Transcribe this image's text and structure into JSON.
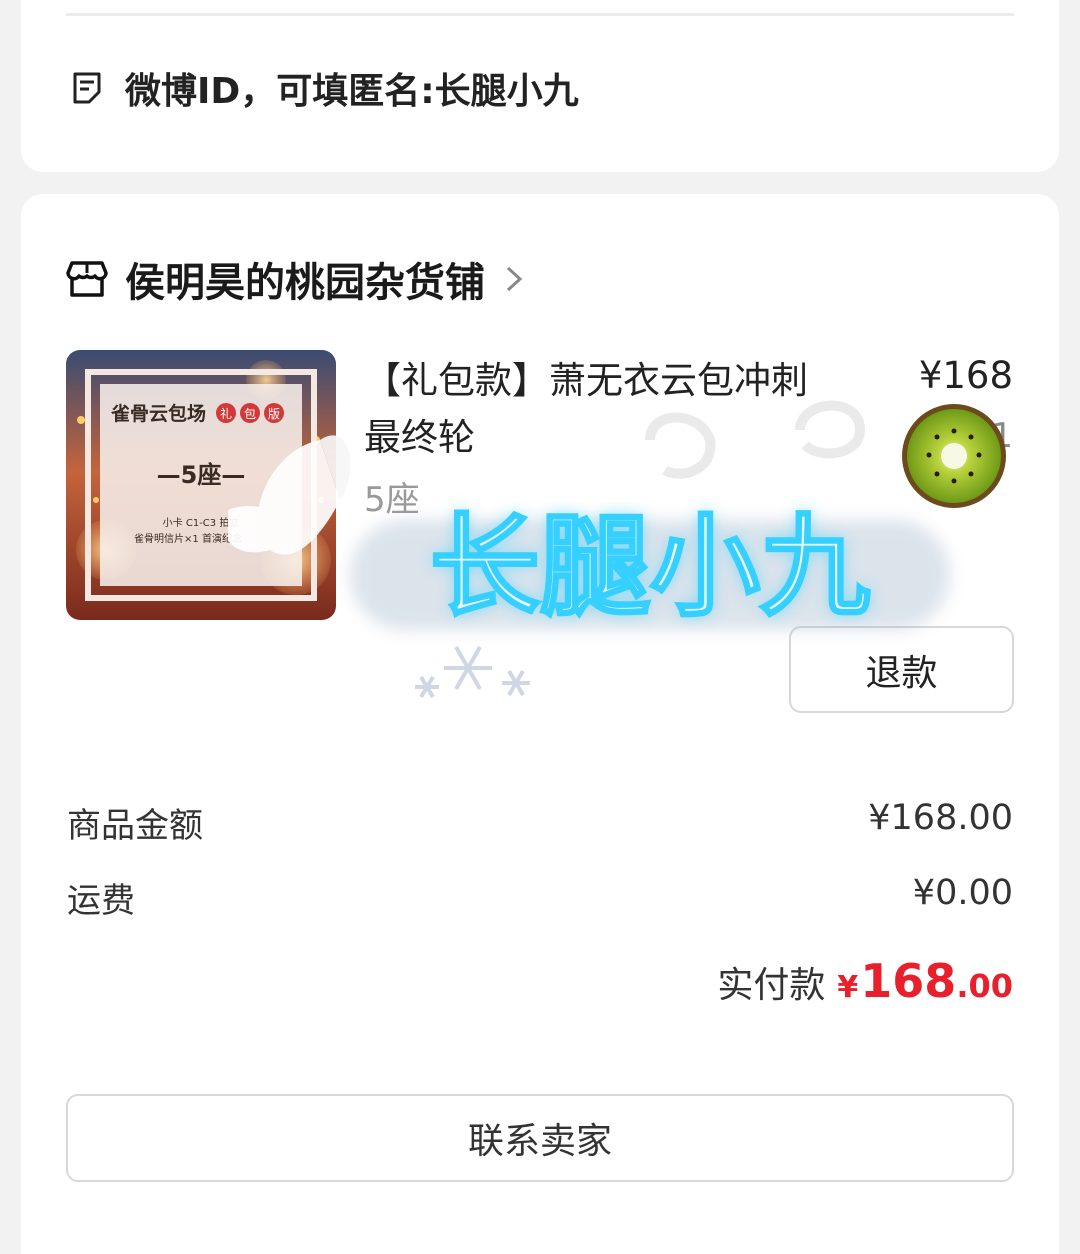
{
  "remark": {
    "text": "微博ID，可填匿名:长腿小九"
  },
  "shop": {
    "name": "侯明昊的桃园杂货铺"
  },
  "product": {
    "title": "【礼包款】萧无衣云包冲刺最终轮",
    "spec": "5座",
    "price": "¥168",
    "quantity": "1",
    "image_texts": {
      "heading": "雀骨云包场",
      "badge": [
        "礼",
        "包",
        "版"
      ],
      "seats": "—5座—",
      "line1": "小卡 C1-C3 拍立",
      "line2": "雀骨明信片×1 首演纪念"
    }
  },
  "refund_label": "退款",
  "summary": {
    "goods_label": "商品金额",
    "goods_value": "¥168.00",
    "shipping_label": "运费",
    "shipping_value": "¥0.00",
    "paid_label": "实付款",
    "paid_symbol": "¥",
    "paid_int": "168",
    "paid_dec": ".00"
  },
  "contact_label": "联系卖家",
  "watermark": {
    "text": "长腿小九"
  },
  "colors": {
    "accent": "#e8202b",
    "glow": "#35d0ff"
  }
}
